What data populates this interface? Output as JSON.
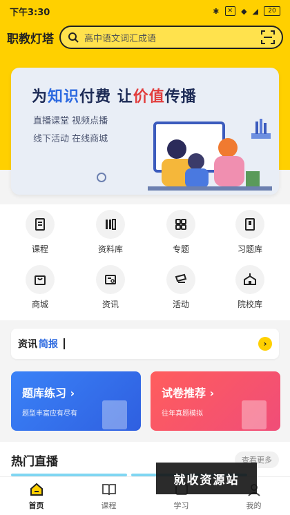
{
  "status_bar": {
    "time": "下午3:30",
    "battery": "20"
  },
  "header": {
    "logo": "职教灯塔",
    "search_placeholder": "高中语文词汇成语"
  },
  "banner": {
    "headline_parts": [
      "为",
      "知识",
      "付费 让",
      "价值",
      "传播"
    ],
    "sub1": "直播课堂  视频点播",
    "sub2": "线下活动  在线商城"
  },
  "grid": {
    "items": [
      {
        "label": "课程",
        "icon": "book-icon"
      },
      {
        "label": "资料库",
        "icon": "library-icon"
      },
      {
        "label": "专题",
        "icon": "grid-icon"
      },
      {
        "label": "习题库",
        "icon": "exercise-icon"
      },
      {
        "label": "商城",
        "icon": "shopping-bag-icon"
      },
      {
        "label": "资讯",
        "icon": "news-icon"
      },
      {
        "label": "活动",
        "icon": "ticket-icon"
      },
      {
        "label": "院校库",
        "icon": "school-icon"
      }
    ]
  },
  "news": {
    "prefix": "资讯",
    "highlight": "简报"
  },
  "cards": [
    {
      "title": "题库练习 ›",
      "subtitle": "题型丰富应有尽有",
      "color": "#3a82f7"
    },
    {
      "title": "试卷推荐 ›",
      "subtitle": "往年真题模拟",
      "color": "#ff5d5d"
    }
  ],
  "hot_live": {
    "title": "热门直播",
    "more": "查看更多"
  },
  "tabbar": {
    "tabs": [
      {
        "label": "首页",
        "active": true
      },
      {
        "label": "课程",
        "active": false
      },
      {
        "label": "学习",
        "active": false
      },
      {
        "label": "我的",
        "active": false
      }
    ]
  },
  "watermark": "就收资源站",
  "colors": {
    "brand": "#ffd000",
    "accent_blue": "#2d6ae0",
    "accent_red": "#e23d3d"
  }
}
